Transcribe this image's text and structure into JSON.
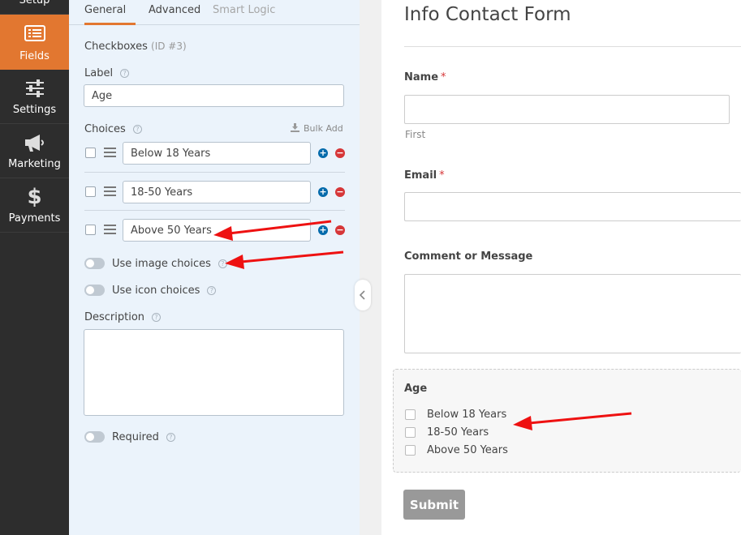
{
  "nav": {
    "items": [
      {
        "label": "Setup",
        "icon": "gear-icon"
      },
      {
        "label": "Fields",
        "icon": "list-icon",
        "active": true
      },
      {
        "label": "Settings",
        "icon": "sliders-icon"
      },
      {
        "label": "Marketing",
        "icon": "megaphone-icon"
      },
      {
        "label": "Payments",
        "icon": "dollar-icon"
      }
    ],
    "active_color": "#e27730"
  },
  "panel": {
    "tabs": [
      {
        "label": "General",
        "active": true
      },
      {
        "label": "Advanced"
      },
      {
        "label": "Smart Logic",
        "disabled": true
      }
    ],
    "field_type": "Checkboxes",
    "field_id": "(ID #3)",
    "label_caption": "Label",
    "label_value": "Age",
    "choices_caption": "Choices",
    "bulk_add": "Bulk Add",
    "choices": [
      {
        "value": "Below 18 Years"
      },
      {
        "value": "18-50 Years"
      },
      {
        "value": "Above 50 Years"
      }
    ],
    "toggles": {
      "image_choices": "Use image choices",
      "icon_choices": "Use icon choices",
      "required": "Required"
    },
    "description_caption": "Description",
    "description_value": ""
  },
  "preview": {
    "form_title": "Info Contact Form",
    "fields": {
      "name_label": "Name",
      "name_required": "*",
      "name_sublabel": "First",
      "email_label": "Email",
      "email_required": "*",
      "comment_label": "Comment or Message",
      "age_label": "Age",
      "age_choices": [
        "Below 18 Years",
        "18-50 Years",
        "Above 50 Years"
      ]
    },
    "submit": "Submit"
  },
  "annotations": {
    "arrow_color": "#ee1111"
  }
}
